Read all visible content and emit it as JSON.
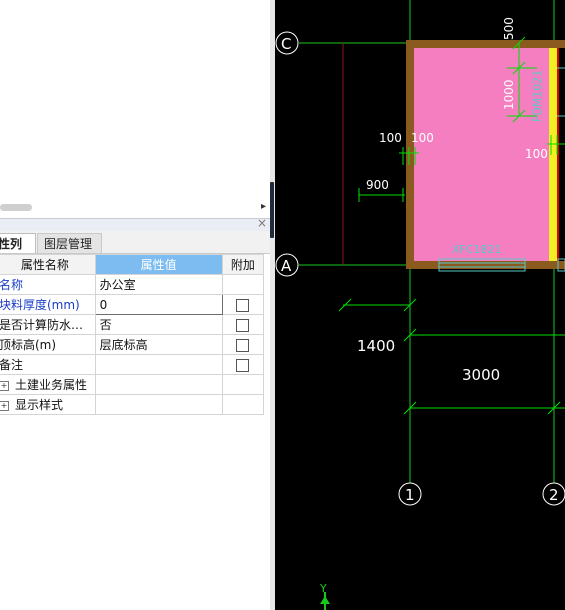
{
  "left_panel": {
    "tabs": {
      "active": "性列表",
      "inactive": "图层管理"
    },
    "table": {
      "col_name": "属性名称",
      "col_value": "属性值",
      "col_extra": "附加",
      "rows": [
        {
          "name": "名称",
          "value": "办公室"
        },
        {
          "name": "块料厚度(mm)",
          "value": "0"
        },
        {
          "name": "是否计算防水…",
          "value": "否"
        },
        {
          "name": "顶标高(m)",
          "value": "层底标高"
        },
        {
          "name": "备注",
          "value": ""
        }
      ],
      "groups": [
        "土建业务属性",
        "显示样式"
      ]
    }
  },
  "cad": {
    "axis_labels": {
      "C": "C",
      "A": "A",
      "one": "1",
      "two": "2",
      "y": "Y"
    },
    "dims": {
      "d500": "500",
      "d1000": "1000",
      "d100a": "100",
      "d100b": "100",
      "d100c": "100",
      "d900": "900",
      "d1400": "1400",
      "d3000": "3000"
    },
    "labels": {
      "door": "FDM1021",
      "window": "XFC1821"
    },
    "colors": {
      "room_fill": "#f57ec0",
      "wall": "#8a5a1e",
      "grid": "#19c819",
      "dim": "#00e000",
      "window": "#57c8c8",
      "white": "#ffffff",
      "red": "#e00000",
      "yellow": "#f2ef22"
    }
  }
}
